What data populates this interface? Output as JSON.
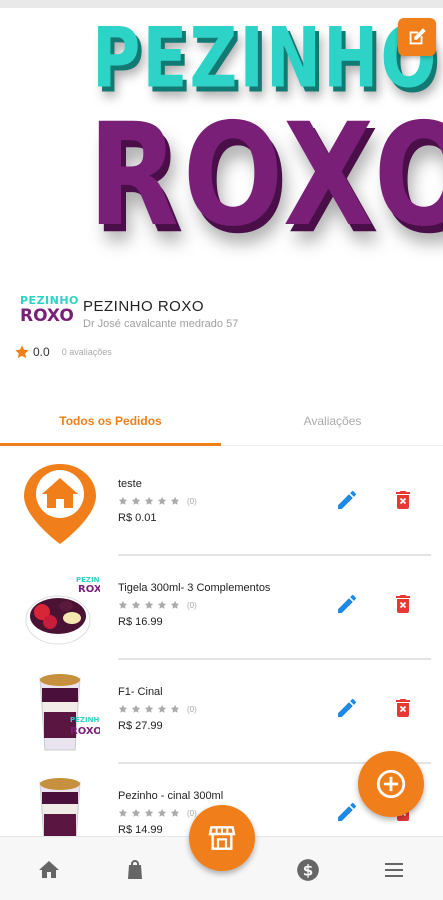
{
  "app": {
    "accent_color": "#f07f1b",
    "brand_teal": "#2ed3c7",
    "brand_purple": "#7a1f78"
  },
  "banner": {
    "logo_line1": "PEZINHO",
    "logo_line2": "ROXO",
    "edit_icon": "edit-square-icon"
  },
  "store": {
    "logo_line1": "PEZINHO",
    "logo_line2": "ROXO",
    "name": "PEZINHO ROXO",
    "address": "Dr José cavalcante medrado 57",
    "rating": "0.0",
    "rating_count": "0 avaliações"
  },
  "tabs": [
    {
      "label": "Todos os Pedidos",
      "active": true
    },
    {
      "label": "Avaliações",
      "active": false
    }
  ],
  "products": [
    {
      "name": "teste",
      "rating_count": "(0)",
      "price": "R$ 0.01",
      "thumb_icon": "home-pin-icon"
    },
    {
      "name": "Tigela 300ml- 3 Complementos",
      "rating_count": "(0)",
      "price": "R$ 16.99",
      "thumb_icon": "acai-bowl-image"
    },
    {
      "name": "F1- Cinal",
      "rating_count": "(0)",
      "price": "R$ 27.99",
      "thumb_icon": "acai-cup-image"
    },
    {
      "name": "Pezinho - cinal 300ml",
      "rating_count": "(0)",
      "price": "R$ 14.99",
      "thumb_icon": "acai-cup-image"
    }
  ],
  "bottom_nav": {
    "items": [
      "home-icon",
      "shopping-bag-icon",
      "store-icon",
      "dollar-icon",
      "menu-icon"
    ]
  },
  "fab": {
    "add_icon": "add-circle-icon"
  }
}
